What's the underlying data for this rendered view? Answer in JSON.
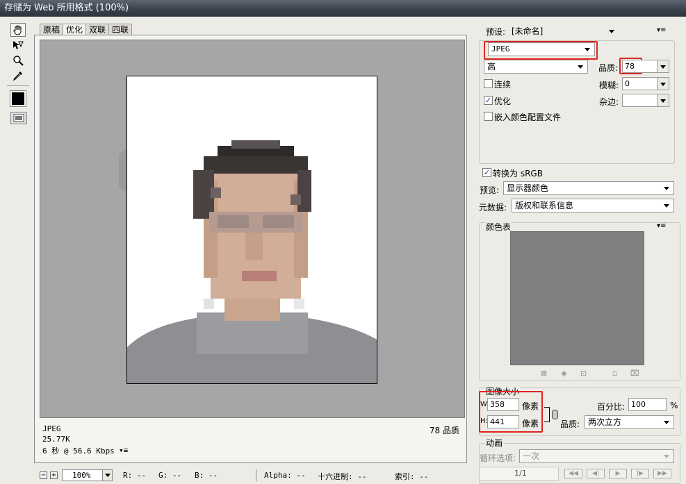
{
  "window": {
    "title": "存储为 Web 所用格式 (100%)"
  },
  "tools": [
    {
      "name": "hand-tool",
      "icon": "hand-icon"
    },
    {
      "name": "slice-select-tool",
      "icon": "slice-select-icon"
    },
    {
      "name": "zoom-tool",
      "icon": "zoom-icon"
    },
    {
      "name": "eyedropper-tool",
      "icon": "eyedropper-icon"
    }
  ],
  "tabs": [
    {
      "label": "原稿",
      "active": false
    },
    {
      "label": "优化",
      "active": true
    },
    {
      "label": "双联",
      "active": false
    },
    {
      "label": "四联",
      "active": false
    }
  ],
  "preview_info": {
    "format": "JPEG",
    "size": "25.77K",
    "download_time": "6 秒 @ 56.6 Kbps",
    "menu_symbol": "▾≡",
    "quality": "78 品质"
  },
  "status": {
    "zoom": "100%",
    "minus": "−",
    "plus": "+",
    "r": "R: --",
    "g": "G: --",
    "b": "B: --",
    "alpha": "Alpha: --",
    "hex": "十六进制: --",
    "index": "索引: --"
  },
  "settings": {
    "preset_label": "预设:",
    "preset_value": "[未命名]",
    "format_value": "JPEG",
    "compression_value": "高",
    "quality_label": "品质:",
    "quality_value": "78",
    "progressive_label": "连续",
    "progressive_checked": false,
    "blur_label": "模糊:",
    "blur_value": "0",
    "optimized_label": "优化",
    "optimized_checked": true,
    "matte_label": "杂边:",
    "matte_value": "",
    "embed_profile_label": "嵌入颜色配置文件",
    "embed_profile_checked": false,
    "convert_srgb_label": "转换为 sRGB",
    "convert_srgb_checked": true,
    "preview_label": "预览:",
    "preview_value": "显示器颜色",
    "metadata_label": "元数据:",
    "metadata_value": "版权和联系信息"
  },
  "color_table": {
    "title": "颜色表"
  },
  "image_size": {
    "title": "图像大小",
    "w_label": "W:",
    "w_value": "358",
    "w_unit": "像素",
    "h_label": "H:",
    "h_value": "441",
    "h_unit": "像素",
    "percent_label": "百分比:",
    "percent_value": "100",
    "percent_unit": "%",
    "quality_label": "品质:",
    "quality_value": "两次立方"
  },
  "animation": {
    "title": "动画",
    "loop_label": "循环选项:",
    "loop_value": "一次",
    "frame_counter": "1/1"
  },
  "colors": {
    "highlight": "#e0241f",
    "canvas_bg": "#a6a6a6",
    "color_table_swatch": "#808080"
  }
}
